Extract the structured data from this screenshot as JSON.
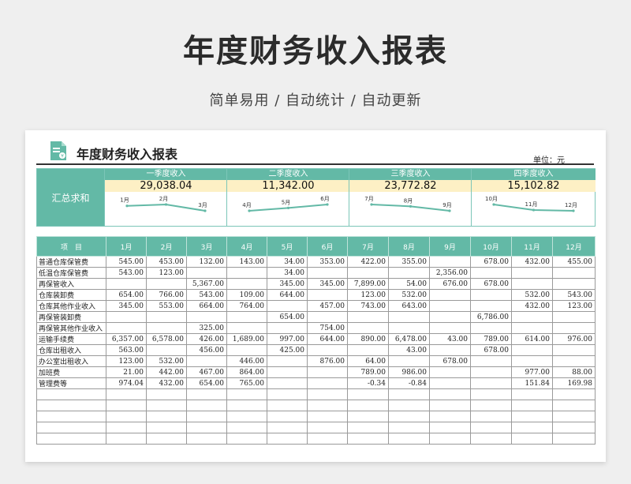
{
  "page": {
    "title": "年度财务收入报表",
    "subtitle": "简单易用  /  自动统计  /  自动更新"
  },
  "sheet": {
    "title": "年度财务收入报表",
    "unit": "单位：元",
    "summary_label": "汇总求和",
    "quarters": [
      {
        "name": "一季度收入",
        "total": "29,038.04",
        "months": [
          "1月",
          "2月",
          "3月"
        ]
      },
      {
        "name": "二季度收入",
        "total": "11,342.00",
        "months": [
          "4月",
          "5月",
          "6月"
        ]
      },
      {
        "name": "三季度收入",
        "total": "23,772.82",
        "months": [
          "7月",
          "8月",
          "9月"
        ]
      },
      {
        "name": "四季度收入",
        "total": "15,102.82",
        "months": [
          "10月",
          "11月",
          "12月"
        ]
      }
    ]
  },
  "chart_data": [
    {
      "type": "line",
      "categories": [
        "1月",
        "2月",
        "3月"
      ],
      "values": [
        10316.06,
        11052.98,
        7669.0
      ],
      "legend": "none",
      "colors": [
        "#63b9a6"
      ]
    },
    {
      "type": "line",
      "categories": [
        "4月",
        "5月",
        "6月"
      ],
      "values": [
        3217.0,
        3743.0,
        4382.0
      ],
      "legend": "none",
      "colors": [
        "#63b9a6"
      ]
    },
    {
      "type": "line",
      "categories": [
        "7月",
        "8月",
        "9月"
      ],
      "values": [
        11298.66,
        9008.16,
        3465.0
      ],
      "legend": "none",
      "colors": [
        "#63b9a6"
      ]
    },
    {
      "type": "line",
      "categories": [
        "10月",
        "11月",
        "12月"
      ],
      "values": [
        10019.0,
        3047.84,
        2035.98
      ],
      "legend": "none",
      "colors": [
        "#63b9a6"
      ]
    }
  ],
  "table": {
    "headers": [
      "项　目",
      "1月",
      "2月",
      "3月",
      "4月",
      "5月",
      "6月",
      "7月",
      "8月",
      "9月",
      "10月",
      "11月",
      "12月"
    ],
    "rows": [
      [
        "普通仓库保管费",
        "545.00",
        "453.00",
        "132.00",
        "143.00",
        "34.00",
        "353.00",
        "422.00",
        "355.00",
        "",
        "678.00",
        "432.00",
        "455.00"
      ],
      [
        "低温仓库保管费",
        "543.00",
        "123.00",
        "",
        "",
        "34.00",
        "",
        "",
        "",
        "2,356.00",
        "",
        "",
        ""
      ],
      [
        "再保管收入",
        "",
        "",
        "5,367.00",
        "",
        "345.00",
        "345.00",
        "7,899.00",
        "54.00",
        "676.00",
        "678.00",
        "",
        ""
      ],
      [
        "仓库装卸费",
        "654.00",
        "766.00",
        "543.00",
        "109.00",
        "644.00",
        "",
        "123.00",
        "532.00",
        "",
        "",
        "532.00",
        "543.00"
      ],
      [
        "仓库其他作业收入",
        "345.00",
        "553.00",
        "664.00",
        "764.00",
        "",
        "457.00",
        "743.00",
        "643.00",
        "",
        "",
        "432.00",
        "123.00"
      ],
      [
        "再保管装卸费",
        "",
        "",
        "",
        "",
        "654.00",
        "",
        "",
        "",
        "",
        "6,786.00",
        "",
        ""
      ],
      [
        "再保管其他作业收入",
        "",
        "",
        "325.00",
        "",
        "",
        "754.00",
        "",
        "",
        "",
        "",
        "",
        ""
      ],
      [
        "运输手续费",
        "6,357.00",
        "6,578.00",
        "426.00",
        "1,689.00",
        "997.00",
        "644.00",
        "890.00",
        "6,478.00",
        "43.00",
        "789.00",
        "614.00",
        "976.00"
      ],
      [
        "仓库出租收入",
        "563.00",
        "",
        "456.00",
        "",
        "425.00",
        "",
        "",
        "43.00",
        "",
        "678.00",
        "",
        ""
      ],
      [
        "办公室出租收入",
        "123.00",
        "532.00",
        "",
        "446.00",
        "",
        "876.00",
        "64.00",
        "",
        "678.00",
        "",
        "",
        ""
      ],
      [
        "加班费",
        "21.00",
        "442.00",
        "467.00",
        "864.00",
        "",
        "",
        "789.00",
        "986.00",
        "",
        "",
        "977.00",
        "88.00"
      ],
      [
        "管理费等",
        "974.04",
        "432.00",
        "654.00",
        "765.00",
        "",
        "",
        "-0.34",
        "-0.84",
        "",
        "",
        "151.84",
        "169.98"
      ],
      [
        "",
        "",
        "",
        "",
        "",
        "",
        "",
        "",
        "",
        "",
        "",
        "",
        ""
      ],
      [
        "",
        "",
        "",
        "",
        "",
        "",
        "",
        "",
        "",
        "",
        "",
        "",
        ""
      ],
      [
        "",
        "",
        "",
        "",
        "",
        "",
        "",
        "",
        "",
        "",
        "",
        "",
        ""
      ],
      [
        "",
        "",
        "",
        "",
        "",
        "",
        "",
        "",
        "",
        "",
        "",
        "",
        ""
      ],
      [
        "",
        "",
        "",
        "",
        "",
        "",
        "",
        "",
        "",
        "",
        "",
        "",
        ""
      ]
    ]
  }
}
